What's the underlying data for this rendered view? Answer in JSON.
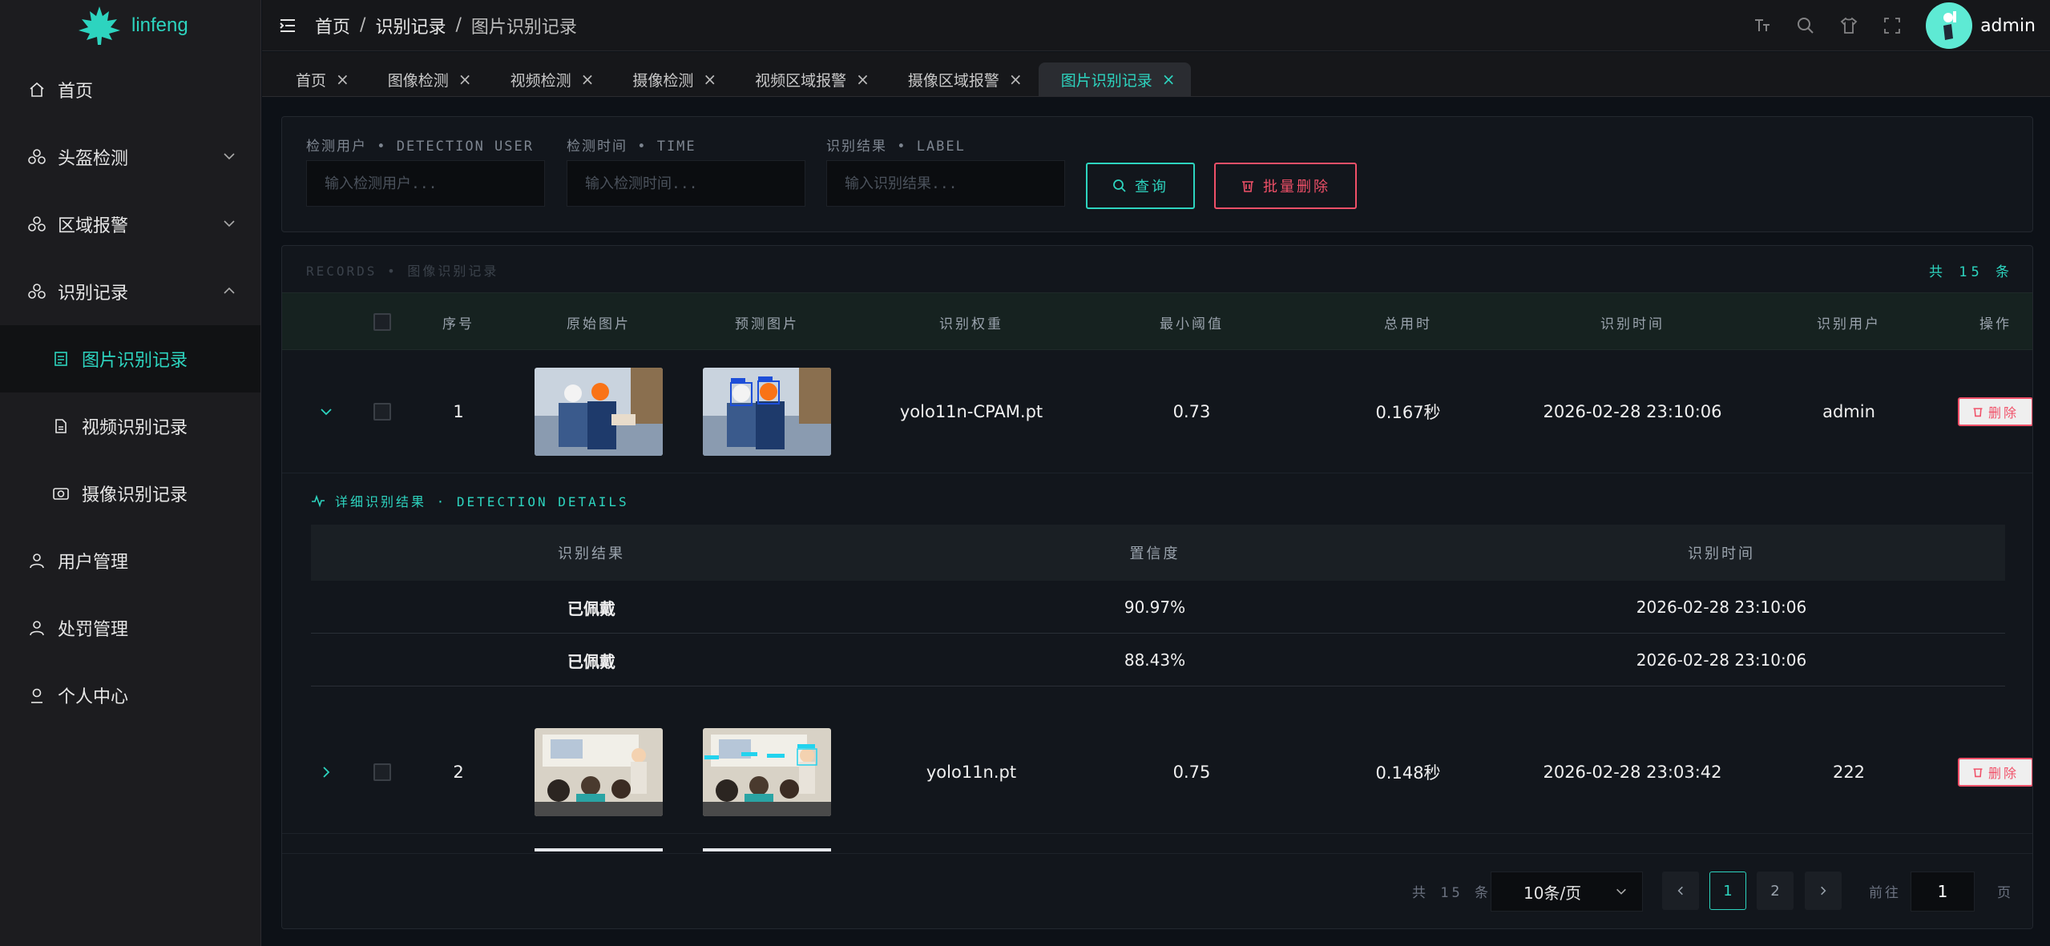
{
  "app": {
    "name": "linfeng"
  },
  "sidebar": {
    "items": [
      {
        "label": "首页"
      },
      {
        "label": "头盔检测"
      },
      {
        "label": "区域报警"
      },
      {
        "label": "识别记录"
      },
      {
        "label": "图片识别记录"
      },
      {
        "label": "视频识别记录"
      },
      {
        "label": "摄像识别记录"
      },
      {
        "label": "用户管理"
      },
      {
        "label": "处罚管理"
      },
      {
        "label": "个人中心"
      }
    ]
  },
  "header": {
    "breadcrumb": [
      "首页",
      "识别记录",
      "图片识别记录"
    ],
    "separator": "/",
    "user": "admin"
  },
  "tabs": [
    {
      "label": "首页"
    },
    {
      "label": "图像检测"
    },
    {
      "label": "视频检测"
    },
    {
      "label": "摄像检测"
    },
    {
      "label": "视频区域报警"
    },
    {
      "label": "摄像区域报警"
    },
    {
      "label": "图片识别记录"
    }
  ],
  "filters": {
    "user_label": "检测用户 • DETECTION USER",
    "user_placeholder": "输入检测用户...",
    "time_label": "检测时间 • TIME",
    "time_placeholder": "输入检测时间...",
    "result_label": "识别结果 • LABEL",
    "result_placeholder": "输入识别结果...",
    "query_button": "查询",
    "batch_delete_button": "批量删除"
  },
  "records": {
    "title": "RECORDS • 图像识别记录",
    "count": "共 15 条",
    "columns": [
      "序号",
      "原始图片",
      "预测图片",
      "识别权重",
      "最小阈值",
      "总用时",
      "识别时间",
      "识别用户",
      "操作"
    ],
    "rows": [
      {
        "index": "1",
        "weight": "yolo11n-CPAM.pt",
        "threshold": "0.73",
        "duration": "0.167秒",
        "time": "2026-02-28 23:10:06",
        "user": "admin",
        "action": "删除"
      },
      {
        "index": "2",
        "weight": "yolo11n.pt",
        "threshold": "0.75",
        "duration": "0.148秒",
        "time": "2026-02-28 23:03:42",
        "user": "222",
        "action": "删除"
      }
    ],
    "detail": {
      "title": "详细识别结果 · DETECTION DETAILS",
      "columns": [
        "识别结果",
        "置信度",
        "识别时间"
      ],
      "rows": [
        {
          "result": "已佩戴",
          "confidence": "90.97%",
          "time": "2026-02-28 23:10:06"
        },
        {
          "result": "已佩戴",
          "confidence": "88.43%",
          "time": "2026-02-28 23:10:06"
        }
      ]
    }
  },
  "pagination": {
    "total": "共 15 条",
    "page_size": "10条/页",
    "pages": [
      "1",
      "2"
    ],
    "current": "1",
    "goto_label": "前往",
    "goto_value": "1",
    "goto_suffix": "页"
  },
  "colors": {
    "accent": "#2dd4bf",
    "danger": "#f05068",
    "background": "#0d1117"
  }
}
